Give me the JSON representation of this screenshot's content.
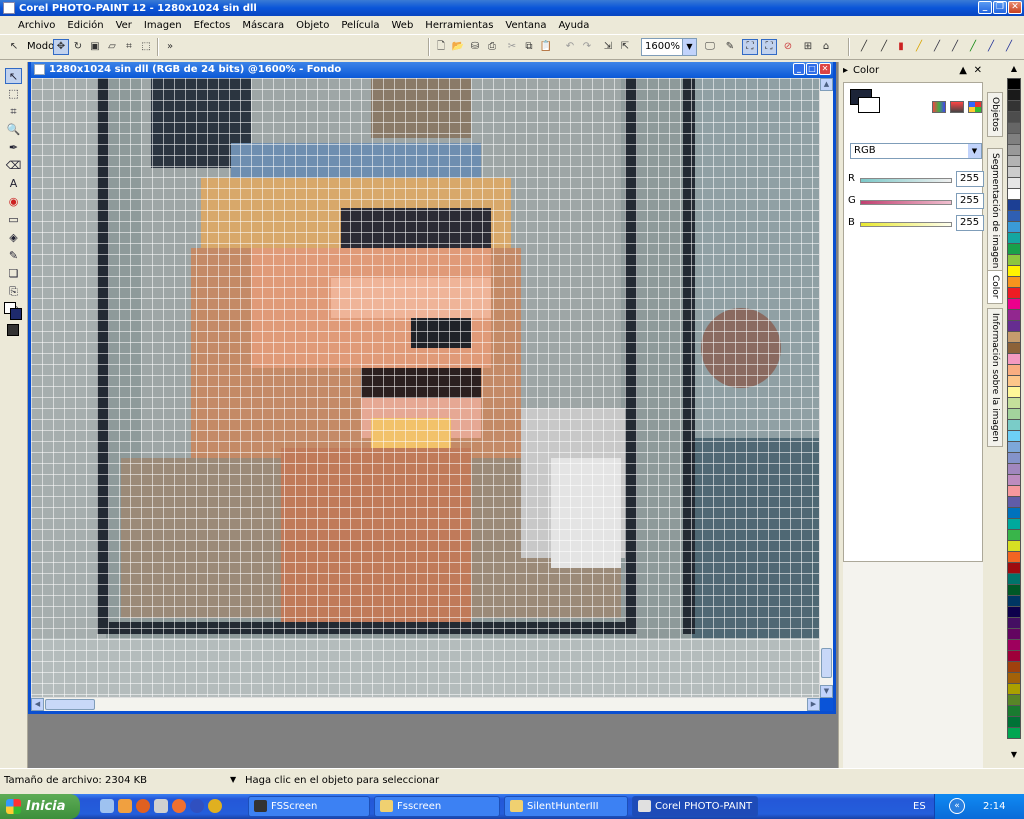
{
  "app": {
    "title": "Corel PHOTO-PAINT 12 - 1280x1024 sin dll"
  },
  "menu": [
    "Archivo",
    "Edición",
    "Ver",
    "Imagen",
    "Efectos",
    "Máscara",
    "Objeto",
    "Película",
    "Web",
    "Herramientas",
    "Ventana",
    "Ayuda"
  ],
  "toolbar": {
    "mode_label": "Modo",
    "zoom_value": "1600%"
  },
  "document": {
    "title": "1280x1024 sin dll (RGB de 24 bits) @1600% - Fondo"
  },
  "docker": {
    "title": "Color",
    "model": "RGB",
    "channels": [
      {
        "label": "R",
        "value": "255",
        "color": "#cc4444"
      },
      {
        "label": "G",
        "value": "255",
        "color": "#44aa44"
      },
      {
        "label": "B",
        "value": "255",
        "color": "#dddd33"
      }
    ],
    "tabs": [
      "Objetos",
      "Segmentación de imagen",
      "Color",
      "Información sobre la imagen"
    ]
  },
  "palette": [
    "#000000",
    "#1a1a1a",
    "#333333",
    "#4d4d4d",
    "#666666",
    "#808080",
    "#999999",
    "#b3b3b3",
    "#cccccc",
    "#e6e6e6",
    "#ffffff",
    "#1c3f94",
    "#2f5fb3",
    "#3a9bd7",
    "#14a6a1",
    "#19a04a",
    "#8cc63f",
    "#fff200",
    "#f7941d",
    "#ed1c24",
    "#ec008c",
    "#92278f",
    "#662d91",
    "#c69c6d",
    "#8c6239",
    "#f49ac1",
    "#f9ad81",
    "#fdc68a",
    "#fff799",
    "#c4df9b",
    "#a3d39c",
    "#7accc8",
    "#6dcff6",
    "#7da7d9",
    "#8493ca",
    "#a187be",
    "#bd8cbf",
    "#f6989d",
    "#605ca8",
    "#0072bc",
    "#00a99d",
    "#39b54a",
    "#d7df23",
    "#f26522",
    "#9e0b0f",
    "#00746b",
    "#005826",
    "#003663",
    "#0d004c",
    "#440e62",
    "#630460",
    "#9e005d",
    "#9e0039",
    "#a0410d",
    "#a36209",
    "#aba000",
    "#598527",
    "#1a7b30",
    "#007236",
    "#00a651"
  ],
  "status": {
    "file_size": "Tamaño de archivo: 2304 KB",
    "hint": "Haga clic en el objeto para seleccionar"
  },
  "taskbar": {
    "start": "Inicia",
    "tasks": [
      {
        "label": "FSScreen"
      },
      {
        "label": "Fsscreen"
      },
      {
        "label": "SilentHunterIII"
      },
      {
        "label": "Corel PHOTO-PAINT ..."
      }
    ],
    "lang": "ES",
    "clock": "2:14"
  }
}
